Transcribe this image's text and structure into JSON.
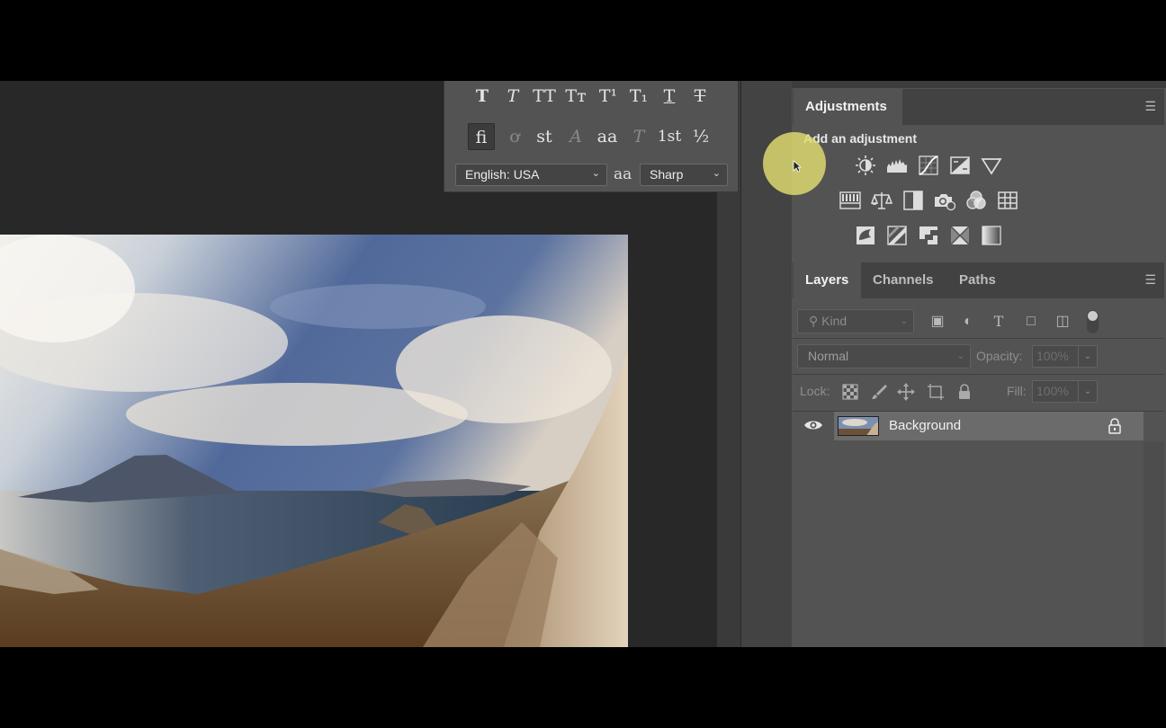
{
  "character_panel": {
    "style_buttons": [
      {
        "glyph": "T",
        "name": "faux-bold-button"
      },
      {
        "glyph": "T",
        "name": "faux-italic-button"
      },
      {
        "glyph": "TT",
        "name": "all-caps-button"
      },
      {
        "glyph": "Tт",
        "name": "small-caps-button"
      },
      {
        "glyph": "T¹",
        "name": "superscript-button"
      },
      {
        "glyph": "T₁",
        "name": "subscript-button"
      },
      {
        "glyph": "T",
        "name": "underline-button"
      },
      {
        "glyph": "T",
        "name": "strikethrough-button"
      }
    ],
    "opentype_buttons": [
      {
        "glyph": "fi",
        "name": "standard-ligatures-button"
      },
      {
        "glyph": "ơ",
        "name": "contextual-alternates-button"
      },
      {
        "glyph": "st",
        "name": "discretionary-ligatures-button"
      },
      {
        "glyph": "A",
        "name": "swash-button"
      },
      {
        "glyph": "aa",
        "name": "stylistic-alternates-button"
      },
      {
        "glyph": "T",
        "name": "titling-alternates-button"
      },
      {
        "glyph": "1st",
        "name": "ordinals-button"
      },
      {
        "glyph": "½",
        "name": "fractions-button"
      }
    ],
    "language": "English: USA",
    "antialias_icon": "aa",
    "antialias": "Sharp"
  },
  "adjustments": {
    "tab": "Adjustments",
    "subtitle": "Add an adjustment",
    "icons_row1": [
      "brightness-contrast-icon",
      "levels-icon",
      "curves-icon",
      "exposure-icon",
      "vibrance-icon"
    ],
    "icons_row2": [
      "hue-saturation-icon",
      "color-balance-icon",
      "black-white-icon",
      "photo-filter-icon",
      "channel-mixer-icon",
      "color-lookup-icon"
    ],
    "icons_row3": [
      "invert-icon",
      "posterize-icon",
      "threshold-icon",
      "selective-color-icon",
      "gradient-map-icon"
    ]
  },
  "layers": {
    "tabs": [
      "Layers",
      "Channels",
      "Paths"
    ],
    "filter_kind": "Kind",
    "blend_mode": "Normal",
    "opacity_label": "Opacity:",
    "opacity_value": "100%",
    "lock_label": "Lock:",
    "fill_label": "Fill:",
    "fill_value": "100%",
    "layer_name": "Background"
  },
  "colors": {
    "panel": "#535353",
    "panel_dark": "#424242",
    "workspace": "#282828",
    "cursor_highlight": "#e2dd70",
    "layer_selected": "#6b6b6b"
  }
}
